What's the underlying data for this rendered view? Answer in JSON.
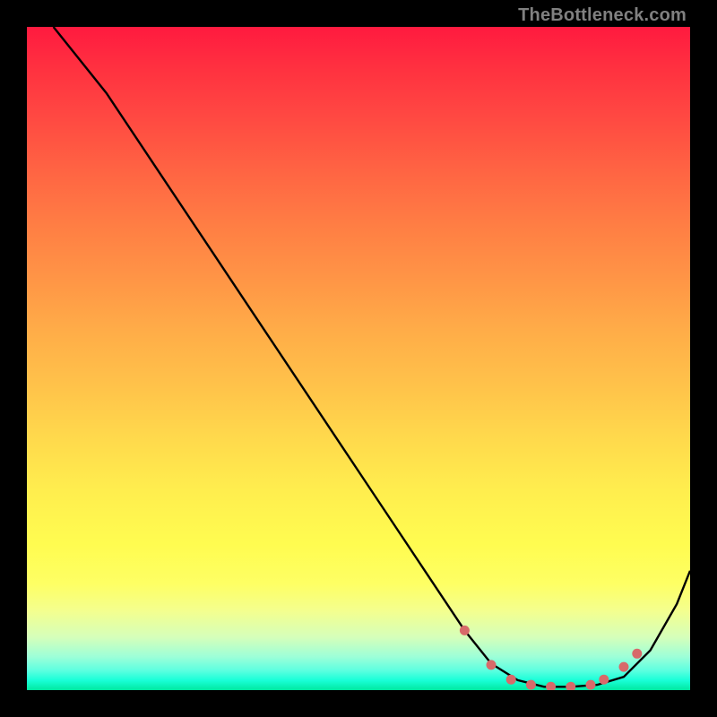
{
  "watermark": "TheBottleneck.com",
  "chart_data": {
    "type": "line",
    "title": "",
    "xlabel": "",
    "ylabel": "",
    "xlim": [
      0,
      100
    ],
    "ylim": [
      0,
      100
    ],
    "series": [
      {
        "name": "curve",
        "x": [
          4,
          12,
          20,
          28,
          36,
          44,
          52,
          60,
          66,
          70,
          74,
          78,
          82,
          86,
          90,
          94,
          98,
          100
        ],
        "values": [
          100,
          90,
          78,
          66,
          54,
          42,
          30,
          18,
          9,
          4,
          1.5,
          0.5,
          0.5,
          0.8,
          2,
          6,
          13,
          18
        ]
      }
    ],
    "highlight_points": {
      "x": [
        66,
        70,
        73,
        76,
        79,
        82,
        85,
        87,
        90,
        92
      ],
      "values": [
        9,
        3.8,
        1.6,
        0.8,
        0.5,
        0.5,
        0.8,
        1.6,
        3.5,
        5.5
      ]
    },
    "colors": {
      "curve": "#000000",
      "points": "#d76a6a",
      "gradient_top": "#ff1a3f",
      "gradient_bottom": "#00e8a0"
    }
  }
}
